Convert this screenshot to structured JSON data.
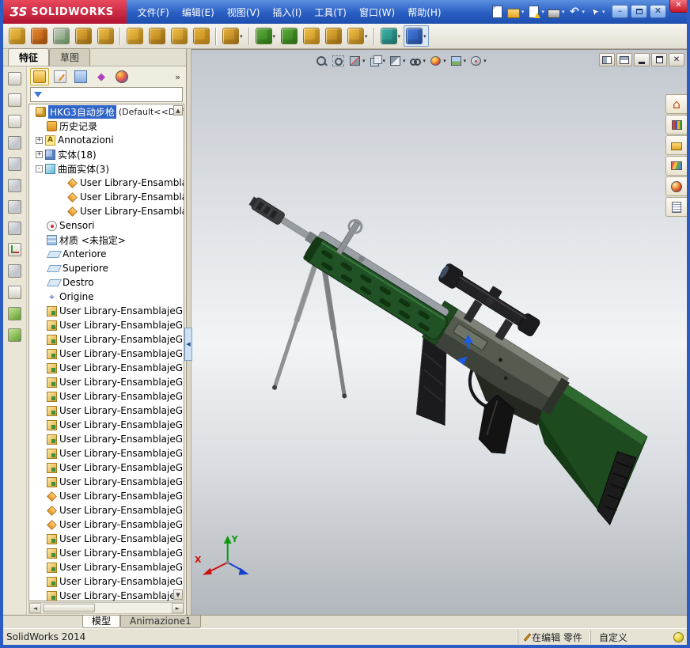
{
  "colors": {
    "accent": "#2b5cc4",
    "selection": "#2f64c8",
    "model_green": "#1f4a20"
  },
  "titlebar": {
    "logo_glyph": "ƷS",
    "logo_text": "SOLIDWORKS",
    "menus": [
      "文件(F)",
      "编辑(E)",
      "视图(V)",
      "插入(I)",
      "工具(T)",
      "窗口(W)",
      "帮助(H)"
    ],
    "tools": [
      {
        "name": "new-document-icon",
        "type": "page"
      },
      {
        "name": "open-icon",
        "type": "folder",
        "caret": true
      },
      {
        "name": "make-drawing-icon",
        "type": "page-warn",
        "caret": true
      },
      {
        "name": "print-icon",
        "type": "printer",
        "caret": true
      },
      {
        "name": "undo-icon",
        "type": "undo",
        "glyph": "↶",
        "caret": true
      },
      {
        "name": "select-icon",
        "type": "pointer",
        "glyph": "➤",
        "caret": true
      },
      {
        "name": "help-icon",
        "type": "help",
        "glyph": "?",
        "caret": true
      }
    ],
    "window_controls": {
      "minimize": "–",
      "close": "✕",
      "app_close": "✕"
    }
  },
  "toolbar": {
    "icons": [
      {
        "name": "edit-part-icon",
        "c1": "#f2c34a",
        "c2": "#c08818"
      },
      {
        "name": "move-component-icon",
        "c1": "#e88830",
        "c2": "#b05510"
      },
      {
        "name": "rotate-component-icon",
        "c1": "#c9cdc9",
        "c2": "#6f9a5f"
      },
      {
        "name": "smart-fasteners-icon",
        "c1": "#e8b23a",
        "c2": "#a87414"
      },
      {
        "name": "exploded-view-icon",
        "c1": "#f2c34a",
        "c2": "#b5801a"
      },
      {
        "sep": true
      },
      {
        "name": "insert-component-icon",
        "c1": "#f2c34a",
        "c2": "#c08818"
      },
      {
        "name": "mate-icon",
        "c1": "#e8b23a",
        "c2": "#a87414"
      },
      {
        "name": "linear-pattern-icon",
        "c1": "#f2c34a",
        "c2": "#b5801a"
      },
      {
        "name": "assembly-features-icon",
        "c1": "#e8b23a",
        "c2": "#c08818"
      },
      {
        "sep": true
      },
      {
        "name": "component-pattern-icon",
        "c1": "#e8b23a",
        "c2": "#a87414",
        "caret": true
      },
      {
        "sep": true
      },
      {
        "name": "reference-geometry-icon",
        "c1": "#5fae3c",
        "c2": "#2f7a1a",
        "caret": true
      },
      {
        "name": "curves-icon",
        "c1": "#5fae3c",
        "c2": "#2f7a1a"
      },
      {
        "name": "instant3d-icon",
        "c1": "#f2c34a",
        "c2": "#c08818"
      },
      {
        "name": "simulation-icon",
        "c1": "#e8b23a",
        "c2": "#a87414"
      },
      {
        "name": "measure-icon",
        "c1": "#f2c34a",
        "c2": "#b5801a",
        "caret": true
      },
      {
        "sep": true
      },
      {
        "name": "spline-icon",
        "c1": "#3fb3a8",
        "c2": "#1f7f78",
        "caret": true
      },
      {
        "name": "sketch-icon",
        "c1": "#4a7ede",
        "c2": "#2450a8",
        "caret": true,
        "pressed": true
      }
    ]
  },
  "left_strip": {
    "icons": [
      {
        "name": "part-template-icon",
        "style": "doc"
      },
      {
        "name": "assembly-template-icon",
        "style": "doc"
      },
      {
        "name": "drawing-template-icon",
        "style": "doc"
      },
      {
        "name": "view-front-icon",
        "style": "cube"
      },
      {
        "name": "view-left-icon",
        "style": "cube"
      },
      {
        "name": "view-top-icon",
        "style": "cube"
      },
      {
        "name": "view-isometric-icon",
        "style": "cube"
      },
      {
        "name": "view-wireframe-icon",
        "style": "cube"
      },
      {
        "name": "reference-triad-icon",
        "style": "triad"
      },
      {
        "name": "sketch-tool-icon",
        "style": "cube"
      },
      {
        "name": "annotation-tool-icon",
        "style": "doc"
      },
      {
        "name": "apply-scene-icon",
        "style": "green"
      },
      {
        "name": "render-tools-icon",
        "style": "green"
      }
    ]
  },
  "panel": {
    "tabs": [
      {
        "label": "特征",
        "active": true
      },
      {
        "label": "草图",
        "active": false
      }
    ],
    "overflow": "»",
    "manager_tabs": [
      {
        "name": "featuremanager-icon",
        "style": "fm",
        "active": true
      },
      {
        "name": "propertymanager-icon",
        "style": "pm"
      },
      {
        "name": "configurationmanager-icon",
        "style": "cm"
      },
      {
        "name": "dimxpertmanager-icon",
        "style": "dx",
        "glyph": "◆"
      },
      {
        "name": "displaymanager-icon",
        "style": "dm"
      }
    ],
    "filter_value": "",
    "tree": {
      "root": {
        "label": "HKG3自动步枪",
        "suffix": "(Default<<Def"
      },
      "scroll_up": "▲",
      "scroll_down": "▼",
      "items": [
        {
          "expand": "",
          "indent": 1,
          "icon": "history",
          "label": "历史记录"
        },
        {
          "expand": "+",
          "indent": 1,
          "icon": "annotations",
          "label": "Annotazioni"
        },
        {
          "expand": "+",
          "indent": 1,
          "icon": "solid-bodies",
          "label": "实体(18)"
        },
        {
          "expand": "-",
          "indent": 1,
          "icon": "surface-bodies",
          "label": "曲面实体(3)"
        },
        {
          "expand": "",
          "indent": 2,
          "icon": "surface-diamond",
          "label": "User Library-Ensambla"
        },
        {
          "expand": "",
          "indent": 2,
          "icon": "surface-diamond",
          "label": "User Library-Ensambla"
        },
        {
          "expand": "",
          "indent": 2,
          "icon": "surface-diamond",
          "label": "User Library-Ensambla"
        },
        {
          "expand": "",
          "indent": 1,
          "icon": "sensors",
          "label": "Sensori"
        },
        {
          "expand": "",
          "indent": 1,
          "icon": "material",
          "label": "材质 <未指定>"
        },
        {
          "expand": "",
          "indent": 1,
          "icon": "plane",
          "label": "Anteriore"
        },
        {
          "expand": "",
          "indent": 1,
          "icon": "plane",
          "label": "Superiore"
        },
        {
          "expand": "",
          "indent": 1,
          "icon": "plane",
          "label": "Destro"
        },
        {
          "expand": "",
          "indent": 1,
          "icon": "origin",
          "label": "Origine"
        },
        {
          "expand": "",
          "indent": 1,
          "icon": "feature",
          "label": "User Library-EnsamblajeG"
        },
        {
          "expand": "",
          "indent": 1,
          "icon": "feature",
          "label": "User Library-EnsamblajeG"
        },
        {
          "expand": "",
          "indent": 1,
          "icon": "feature",
          "label": "User Library-EnsamblajeG"
        },
        {
          "expand": "",
          "indent": 1,
          "icon": "feature",
          "label": "User Library-EnsamblajeG"
        },
        {
          "expand": "",
          "indent": 1,
          "icon": "feature",
          "label": "User Library-EnsamblajeG"
        },
        {
          "expand": "",
          "indent": 1,
          "icon": "feature",
          "label": "User Library-EnsamblajeG"
        },
        {
          "expand": "",
          "indent": 1,
          "icon": "feature",
          "label": "User Library-EnsamblajeG"
        },
        {
          "expand": "",
          "indent": 1,
          "icon": "feature",
          "label": "User Library-EnsamblajeG"
        },
        {
          "expand": "",
          "indent": 1,
          "icon": "feature",
          "label": "User Library-EnsamblajeG"
        },
        {
          "expand": "",
          "indent": 1,
          "icon": "feature",
          "label": "User Library-EnsamblajeG"
        },
        {
          "expand": "",
          "indent": 1,
          "icon": "feature",
          "label": "User Library-EnsamblajeG"
        },
        {
          "expand": "",
          "indent": 1,
          "icon": "feature",
          "label": "User Library-EnsamblajeG"
        },
        {
          "expand": "",
          "indent": 1,
          "icon": "feature",
          "label": "User Library-EnsamblajeG"
        },
        {
          "expand": "",
          "indent": 1,
          "icon": "surface-diamond",
          "label": "User Library-EnsamblajeG"
        },
        {
          "expand": "",
          "indent": 1,
          "icon": "surface-diamond",
          "label": "User Library-EnsamblajeG"
        },
        {
          "expand": "",
          "indent": 1,
          "icon": "surface-diamond",
          "label": "User Library-EnsamblajeG"
        },
        {
          "expand": "",
          "indent": 1,
          "icon": "feature",
          "label": "User Library-EnsamblajeG"
        },
        {
          "expand": "",
          "indent": 1,
          "icon": "feature",
          "label": "User Library-EnsamblajeG"
        },
        {
          "expand": "",
          "indent": 1,
          "icon": "feature",
          "label": "User Library-EnsamblajeG"
        },
        {
          "expand": "",
          "indent": 1,
          "icon": "feature",
          "label": "User Library-EnsamblajeG"
        },
        {
          "expand": "",
          "indent": 1,
          "icon": "feature",
          "label": "User Library-EnsamblajeG"
        }
      ]
    }
  },
  "viewport": {
    "headsup": [
      {
        "name": "zoom-fit-icon"
      },
      {
        "name": "zoom-area-icon"
      },
      {
        "name": "section-view-icon",
        "caret": true
      },
      {
        "name": "view-orientation-icon",
        "caret": true
      },
      {
        "name": "display-style-icon",
        "caret": true
      },
      {
        "name": "hide-show-icon",
        "caret": true
      },
      {
        "name": "appearances-icon",
        "caret": true
      },
      {
        "name": "scene-icon",
        "caret": true
      },
      {
        "name": "view-settings-icon",
        "caret": true
      }
    ],
    "doc_controls": [
      {
        "name": "viewport-split-horizontal-icon",
        "style": "pane"
      },
      {
        "name": "viewport-split-vertical-icon",
        "style": "pane2"
      },
      {
        "name": "minimize-document-icon",
        "style": "min"
      },
      {
        "name": "restore-document-icon",
        "style": "restore"
      },
      {
        "name": "close-document-icon",
        "style": "close",
        "glyph": "✕"
      }
    ],
    "task_tabs": [
      {
        "name": "home-icon",
        "style": "home",
        "glyph": "⌂"
      },
      {
        "name": "design-library-icon",
        "style": "books"
      },
      {
        "name": "file-explorer-icon",
        "style": "folder"
      },
      {
        "name": "view-palette-icon",
        "style": "palette"
      },
      {
        "name": "appearances-icon",
        "style": "ball"
      },
      {
        "name": "custom-properties-icon",
        "style": "props"
      }
    ],
    "triad": {
      "x": "X",
      "y": "Y"
    },
    "model_name": "HKG3 自动步枪 3D model"
  },
  "bottom_tabs": [
    {
      "label": "模型",
      "active": true
    },
    {
      "label": "Animazione1",
      "active": false
    }
  ],
  "statusbar": {
    "app": "SolidWorks 2014",
    "editing": "在编辑 零件",
    "custom": "自定义"
  }
}
